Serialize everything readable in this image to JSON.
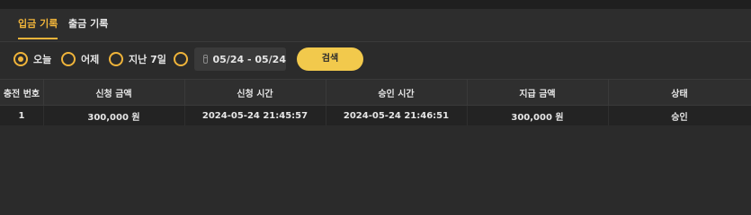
{
  "tabs": [
    {
      "label": "입금 기록",
      "active": true
    },
    {
      "label": "출금 기록",
      "active": false
    }
  ],
  "filters": {
    "radios": [
      {
        "label": "오늘",
        "checked": true
      },
      {
        "label": "어제",
        "checked": false
      },
      {
        "label": "지난 7일",
        "checked": false
      },
      {
        "label": "",
        "checked": false
      }
    ],
    "date_range": "05/24 - 05/24",
    "search_label": "검색"
  },
  "table": {
    "headers": [
      "충전 번호",
      "신청 금액",
      "신청 시간",
      "승인 시간",
      "지급 금액",
      "상태"
    ],
    "rows": [
      [
        "1",
        "300,000 원",
        "2024-05-24 21:45:57",
        "2024-05-24 21:46:51",
        "300,000 원",
        "승인"
      ]
    ]
  },
  "colors": {
    "accent": "#f0b43a",
    "button": "#f2c94c",
    "background": "#2b2b2b"
  }
}
